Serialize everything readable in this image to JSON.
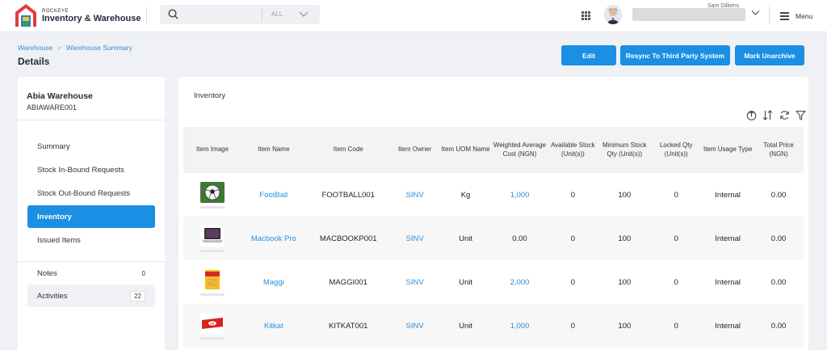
{
  "app": {
    "brand_top": "ROCKEYE",
    "brand_main": "Inventory & Warehouse"
  },
  "search": {
    "placeholder": "",
    "filter": "ALL"
  },
  "user": {
    "name": "Sam Dilkens"
  },
  "menu_label": "Menu",
  "breadcrumb": [
    "Warehouse",
    "Warehouse Summary"
  ],
  "page_title": "Details",
  "actions": {
    "edit": "Edit",
    "resync": "Resync To Third Party System",
    "unarchive": "Mark Unarchive"
  },
  "warehouse": {
    "name": "Abia Warehouse",
    "code": "ABIAWARE001"
  },
  "nav": [
    "Summary",
    "Stock In-Bound Requests",
    "Stock Out-Bound Requests",
    "Inventory",
    "Issued Items"
  ],
  "active_nav": "Inventory",
  "notes": {
    "label": "Notes",
    "count": "0"
  },
  "activities": {
    "label": "Activities",
    "count": "22"
  },
  "inventory": {
    "title": "Inventory",
    "columns": [
      "Item Image",
      "Item Name",
      "Item Code",
      "Item Owner",
      "Item UOM Name",
      "Weighted Average Cost (NGN)",
      "Available Stock (Unit(s))",
      "Minimum Stock Qty (Unit(s))",
      "Locked Qty (Unit(s))",
      "Item Usage Type",
      "Total Price (NGN)"
    ],
    "rows": [
      {
        "image": "football",
        "name": "FootBall",
        "code": "FOOTBALL001",
        "owner": "SINV",
        "uom": "Kg",
        "avg_cost": "1,000",
        "available": "0",
        "min_stock": "100",
        "locked": "0",
        "usage": "Internal",
        "total": "0.00"
      },
      {
        "image": "laptop",
        "name": "Macbook Pro",
        "code": "MACBOOKP001",
        "owner": "SINV",
        "uom": "Unit",
        "avg_cost": "0.00",
        "available": "0",
        "min_stock": "100",
        "locked": "0",
        "usage": "Internal",
        "total": "0.00"
      },
      {
        "image": "noodles",
        "name": "Maggi",
        "code": "MAGGI001",
        "owner": "SINV",
        "uom": "Unit",
        "avg_cost": "2,000",
        "available": "0",
        "min_stock": "100",
        "locked": "0",
        "usage": "Internal",
        "total": "0.00"
      },
      {
        "image": "chocolate",
        "name": "Kitkat",
        "code": "KITKAT001",
        "owner": "SINV",
        "uom": "Unit",
        "avg_cost": "1,000",
        "available": "0",
        "min_stock": "100",
        "locked": "0",
        "usage": "Internal",
        "total": "0.00"
      }
    ]
  },
  "colors": {
    "accent": "#1a8fe3",
    "link": "#2d8fd8",
    "background": "#f0f1f4"
  }
}
